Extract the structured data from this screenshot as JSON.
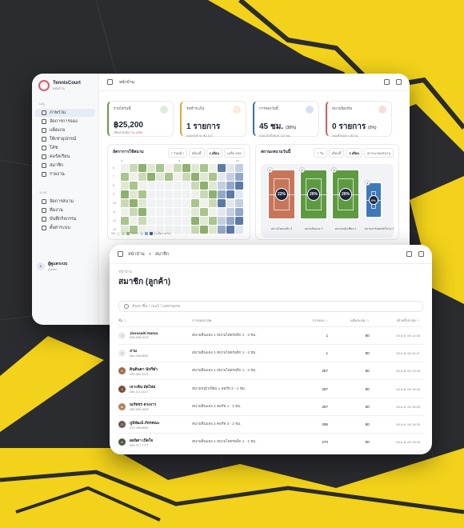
{
  "colors": {
    "accent": "#f2d21a",
    "bg": "#2b2c30"
  },
  "back": {
    "brand": "TennisCourt",
    "brand_sub": "หลังบ้าน",
    "sec_main": "เมนู",
    "nav": [
      "ภาพรวม",
      "จัดการการจอง",
      "แพ็คเกจ",
      "ให้เช่าอุปกรณ์",
      "โค้ช",
      "คอร์สเรียน",
      "สมาชิก",
      "รายงาน"
    ],
    "sec_sys": "ระบบ",
    "nav_sys": [
      "จัดการสนาม",
      "ทีมงาน",
      "บันทึกกิจกรรม",
      "ตั้งค่าระบบ"
    ],
    "user_name": "ผู้ดูแลระบบ",
    "user_role": "Admin",
    "user_initial": "ผ",
    "crumb": "หน้าบ้าน",
    "cards": [
      {
        "label": "รายได้วันนี้",
        "value": "฿25,200",
        "sub": "เทียบกับเมื่อวาน",
        "delta": "-20%",
        "color": "#6a9a4a"
      },
      {
        "label": "รอชำระเงิน",
        "value": "1 รายการ",
        "sub": "ยอดรอชำระ ฿1,872",
        "delta": "",
        "color": "#e0a43a"
      },
      {
        "label": "การจองวันนี้",
        "value": "45 ชม.",
        "value2": "(38%)",
        "sub": "จองแล้วทั้งหมด 119 ชม.",
        "delta": "",
        "color": "#3a6fb0"
      },
      {
        "label": "สนามปิดปรับ",
        "value": "0 รายการ",
        "value2": "(0%)",
        "sub": "ของทั้งหมด 4 สนาม",
        "delta": "",
        "color": "#d85a5a"
      }
    ],
    "heat_title": "อัตราการใช้สนาม",
    "heat_chips": [
      "7 วันหน้า",
      "เดือนนี้",
      "3 เดือน",
      "เฉลี่ย 18%"
    ],
    "heat_cols": [
      "จ.",
      "",
      "",
      "",
      "",
      "",
      "",
      "",
      "ส.",
      "",
      "",
      "",
      "",
      "",
      "",
      "",
      "อา."
    ],
    "heat_rows": [
      "6",
      "7",
      "8",
      "9",
      "10",
      "11",
      "12",
      "13"
    ],
    "heat_legend": "0%",
    "heat_legend2": "100%",
    "heat_legend3": "(เฉลี่ยรายวัน)",
    "court_title": "สถานะสนามวันนี้",
    "court_chips": [
      "7 วัน",
      "เดือนนี้",
      "3 เดือน",
      "สถานะของสนาม"
    ],
    "courts": [
      {
        "num": "1",
        "pct": "22%",
        "name": "สนามไฮดรอลิก 3",
        "color": "#c8765a"
      },
      {
        "num": "2",
        "pct": "20%",
        "name": "สนามดินแดง 1",
        "color": "#5e9a42"
      },
      {
        "num": "3",
        "pct": "20%",
        "name": "สนามหญ้าเทียม 1",
        "color": "#5e9a42"
      },
      {
        "num": "4",
        "pct": "0%",
        "name": "สนามฮาร์ดคอร์ทในร่ม 1",
        "color": "#3d78b8"
      }
    ]
  },
  "front": {
    "crumb_home": "หน้าบ้าน",
    "crumb_sep": ">",
    "crumb_cur": "สมาชิก",
    "sub_crumb": "หน้าบ้าน",
    "title": "สมาชิก (ลูกค้า)",
    "search_placeholder": "ค้นหาชื่อ / เบอร์ / username",
    "headers": [
      "ชื่อ ↑↓",
      "การจองล่าสุด",
      "การจอง ↑↓",
      "แต้มสะสม ↑↓",
      "เข้าครั้งล่าสุด ↑↓"
    ],
    "rows": [
      {
        "name": "Jiarasaiti Nama",
        "phone": "098-998-3476",
        "last": "สนามดินแดง 1 สนามไฮดรอลิก 1 - 2 ชม.",
        "count": "1",
        "points": "80",
        "date": "25 ต.ค. 69 12:36",
        "av": "ว"
      },
      {
        "name": "ภาม",
        "phone": "084-008-8081",
        "last": "สนามดินแดง 1 สนามไฮดรอลิก 1 - 2 ชม.",
        "count": "1",
        "points": "80",
        "date": "08 ม.ค. 69 20:47",
        "av": "ภ"
      },
      {
        "name": "ดินดินดา นักกีฬา",
        "phone": "095-552-2221",
        "last": "สนามดินแดง 1 สนามไฮดรอลิก 1 - 2 ชม.",
        "count": "287",
        "points": "80",
        "date": "08 ม.ค. 69 19:35",
        "av": "ด"
      },
      {
        "name": "เจาะดิน มัดไหม่",
        "phone": "080-111-1110",
        "last": "สนามหญ้าเทียม 1 คอร์ท 3 - 1 ชม.",
        "count": "297",
        "points": "80",
        "date": "08 ม.ค. 69 18:36",
        "av": "จ"
      },
      {
        "name": "ณรัชชร ตวงงาว",
        "phone": "085-599-9999",
        "last": "สนามดินแดง 2 คอร์ท 1 - 2 ชม.",
        "count": "297",
        "points": "80",
        "date": "08 ม.ค. 69 18:35",
        "av": "ณ"
      },
      {
        "name": "ภูมิพัฒน์ ภัทรคณะ",
        "phone": "072-098-8080",
        "last": "สนามดินแดง 2 คอร์ท 3 - 2 ชม.",
        "count": "295",
        "points": "80",
        "date": "08 ม.ค. 69 18:35",
        "av": "ภ"
      },
      {
        "name": "ผลนิดา เปิดใจ",
        "phone": "089-377-7777",
        "last": "สนามดินแดง 1 สนามไฮดรอลิก 1 - 1 ชม.",
        "count": "270",
        "points": "80",
        "date": "08 ม.ค. 69 18:35",
        "av": "ผ"
      }
    ]
  }
}
